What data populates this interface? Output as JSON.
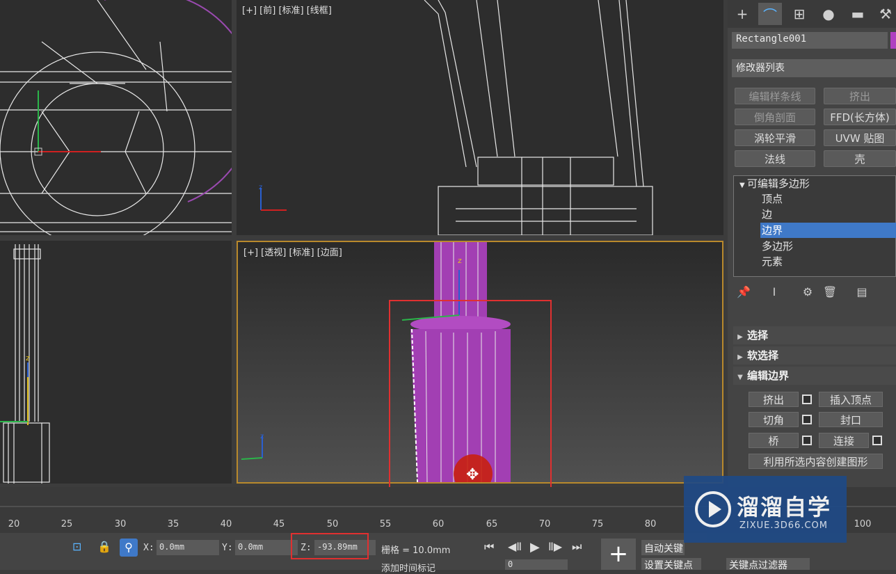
{
  "viewports": {
    "front_label": "[+] [前] [标准] [线框]",
    "persp_label": "[+] [透视] [标准] [边面]"
  },
  "axes": {
    "x": "x",
    "y": "y",
    "z": "z"
  },
  "command_panel": {
    "object_name": "Rectangle001",
    "modifier_list": "修改器列表",
    "buttons": [
      {
        "label": "编辑样条线",
        "enabled": false
      },
      {
        "label": "挤出",
        "enabled": false
      },
      {
        "label": "倒角剖面",
        "enabled": false
      },
      {
        "label": "FFD(长方体)",
        "enabled": true
      },
      {
        "label": "涡轮平滑",
        "enabled": true
      },
      {
        "label": "UVW 贴图",
        "enabled": true
      },
      {
        "label": "法线",
        "enabled": true
      },
      {
        "label": "壳",
        "enabled": true
      }
    ],
    "stack": {
      "root": "可编辑多边形",
      "items": [
        "顶点",
        "边",
        "边界",
        "多边形",
        "元素"
      ],
      "selected": "边界"
    },
    "rollouts": {
      "select": "选择",
      "soft_select": "软选择",
      "edit_border": "编辑边界"
    },
    "edit_border_buttons": {
      "extrude": "挤出",
      "insert_vertex": "插入顶点",
      "chamfer": "切角",
      "cap": "封口",
      "bridge": "桥",
      "connect": "连接",
      "create_shape": "利用所选内容创建图形"
    }
  },
  "timeline": {
    "ticks": [
      "20",
      "25",
      "30",
      "35",
      "40",
      "45",
      "50",
      "55",
      "60",
      "65",
      "70",
      "75",
      "80",
      "100"
    ]
  },
  "status": {
    "x_label": "X:",
    "x_value": "0.0mm",
    "y_label": "Y:",
    "y_value": "0.0mm",
    "z_label": "Z:",
    "z_value": "-93.89mm",
    "grid": "栅格 = 10.0mm",
    "auto_key": "自动关键",
    "set_key": "设置关键点",
    "key_filter": "关键点过滤器",
    "frame_value": "0",
    "add_time_tag": "添加时间标记"
  },
  "watermark": {
    "brand": "溜溜自学",
    "url": "ZIXUE.3D66.COM"
  },
  "colors": {
    "accent": "#3f79c8",
    "object": "#a23fb3",
    "highlight": "#e03030",
    "viewport_border": "#b9892c"
  }
}
